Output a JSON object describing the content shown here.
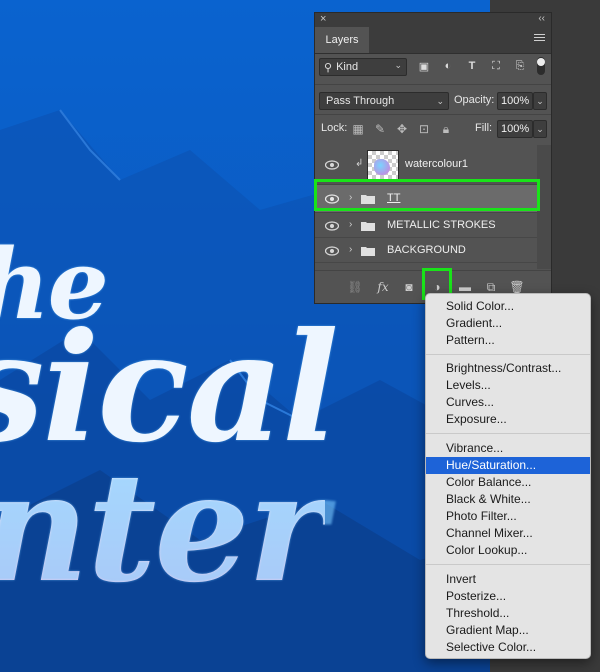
{
  "panel": {
    "tab_label": "Layers",
    "kind_label": "Kind",
    "blend_mode": "Pass Through",
    "opacity_label": "Opacity:",
    "opacity_value": "100%",
    "lock_label": "Lock:",
    "fill_label": "Fill:",
    "fill_value": "100%"
  },
  "layers": [
    {
      "name": "watercolour1",
      "type": "clipped-layer"
    },
    {
      "name": "TT",
      "type": "group",
      "selected": true
    },
    {
      "name": "METALLIC STROKES",
      "type": "group"
    },
    {
      "name": "BACKGROUND",
      "type": "group"
    }
  ],
  "adjustment_menu": {
    "groups": [
      [
        "Solid Color...",
        "Gradient...",
        "Pattern..."
      ],
      [
        "Brightness/Contrast...",
        "Levels...",
        "Curves...",
        "Exposure..."
      ],
      [
        "Vibrance...",
        "Hue/Saturation...",
        "Color Balance...",
        "Black & White...",
        "Photo Filter...",
        "Channel Mixer...",
        "Color Lookup..."
      ],
      [
        "Invert",
        "Posterize...",
        "Threshold...",
        "Gradient Map...",
        "Selective Color..."
      ]
    ],
    "active_item": "Hue/Saturation...",
    "highlight_color": "#1d63d8"
  },
  "artwork": {
    "line1": "he",
    "line2": "sical",
    "line3": "nter"
  },
  "colors": {
    "canvas_blue": "#0a5bc6",
    "panel_bg": "#535353",
    "callout_green": "#19e319"
  }
}
